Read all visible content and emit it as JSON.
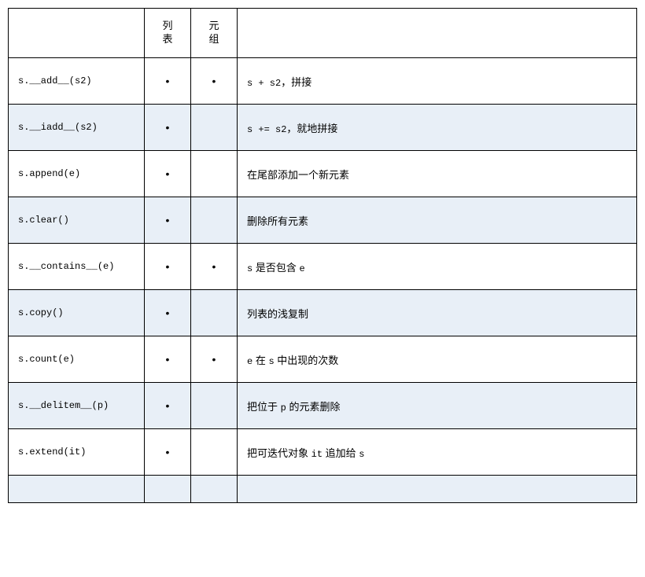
{
  "headers": {
    "method": "",
    "list": "列表",
    "tuple": "元组",
    "desc": ""
  },
  "dot": "•",
  "rows": [
    {
      "alt": false,
      "method": "s.__add__(s2)",
      "list": true,
      "tuple": true,
      "desc_pre": "s + s2",
      "desc_zh": "，拼接"
    },
    {
      "alt": true,
      "method": "s.__iadd__(s2)",
      "list": true,
      "tuple": false,
      "desc_pre": "s += s2",
      "desc_zh": "，就地拼接"
    },
    {
      "alt": false,
      "method": "s.append(e)",
      "list": true,
      "tuple": false,
      "desc_pre": "",
      "desc_zh": "在尾部添加一个新元素"
    },
    {
      "alt": true,
      "method": "s.clear()",
      "list": true,
      "tuple": false,
      "desc_pre": "",
      "desc_zh": "删除所有元素"
    },
    {
      "alt": false,
      "method": "s.__contains__(e)",
      "list": true,
      "tuple": true,
      "desc_pre": "s",
      "desc_zh": " 是否包含 ",
      "desc_post": "e"
    },
    {
      "alt": true,
      "method": "s.copy()",
      "list": true,
      "tuple": false,
      "desc_pre": "",
      "desc_zh": "列表的浅复制"
    },
    {
      "alt": false,
      "method": "s.count(e)",
      "list": true,
      "tuple": true,
      "desc_pre": "e",
      "desc_zh": " 在 ",
      "desc_mid": "s",
      "desc_zh2": " 中出现的次数"
    },
    {
      "alt": true,
      "method": "s.__delitem__(p)",
      "list": true,
      "tuple": false,
      "desc_pre": "",
      "desc_zh": "把位于 ",
      "desc_mid": "p",
      "desc_zh2": " 的元素删除"
    },
    {
      "alt": false,
      "method": "s.extend(it)",
      "list": true,
      "tuple": false,
      "desc_pre": "",
      "desc_zh": "把可迭代对象 ",
      "desc_mid": "it",
      "desc_zh2": " 追加给 ",
      "desc_post": "s"
    }
  ]
}
